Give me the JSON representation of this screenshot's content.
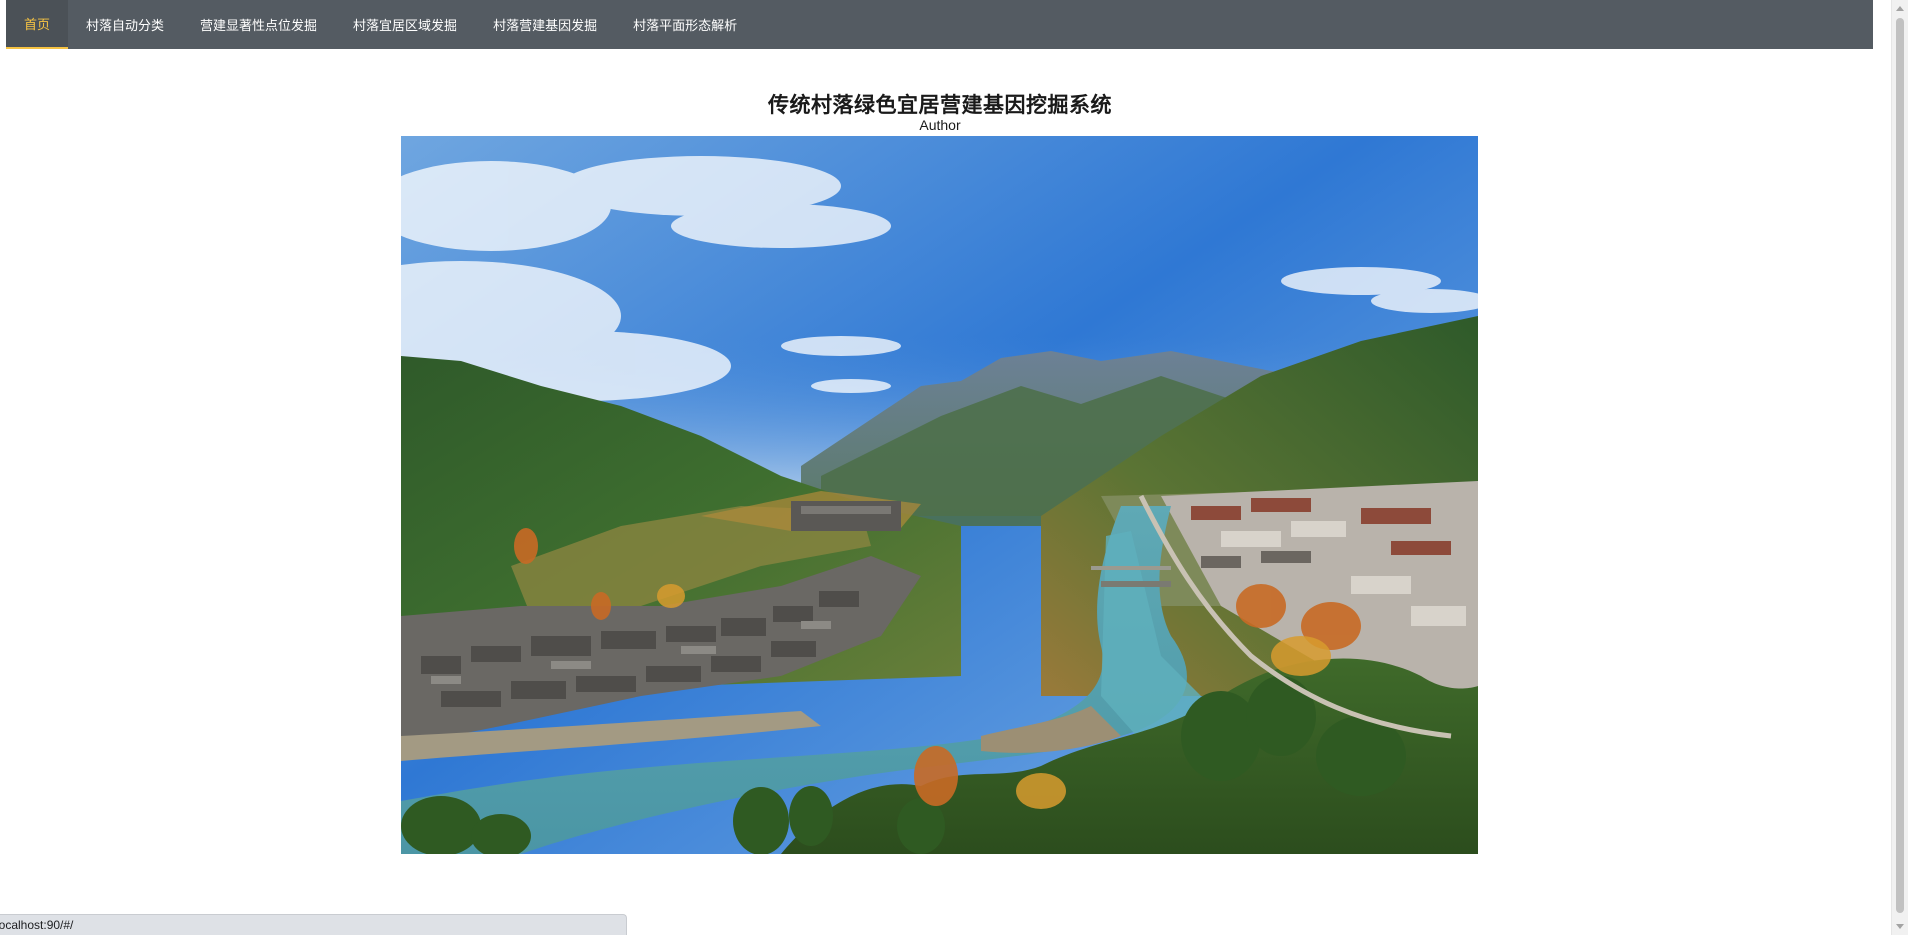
{
  "nav": {
    "items": [
      {
        "label": "首页",
        "active": true
      },
      {
        "label": "村落自动分类",
        "active": false
      },
      {
        "label": "营建显著性点位发掘",
        "active": false
      },
      {
        "label": "村落宜居区域发掘",
        "active": false
      },
      {
        "label": "村落营建基因发掘",
        "active": false
      },
      {
        "label": "村落平面形态解析",
        "active": false
      }
    ]
  },
  "main": {
    "title": "传统村落绿色宜居营建基因挖掘系统",
    "subtitle": "Author"
  },
  "status": {
    "url": "localhost:90/#/"
  },
  "colors": {
    "navbar_bg": "#545b62",
    "active_text": "#f6c343",
    "nav_text": "#ffffff"
  }
}
